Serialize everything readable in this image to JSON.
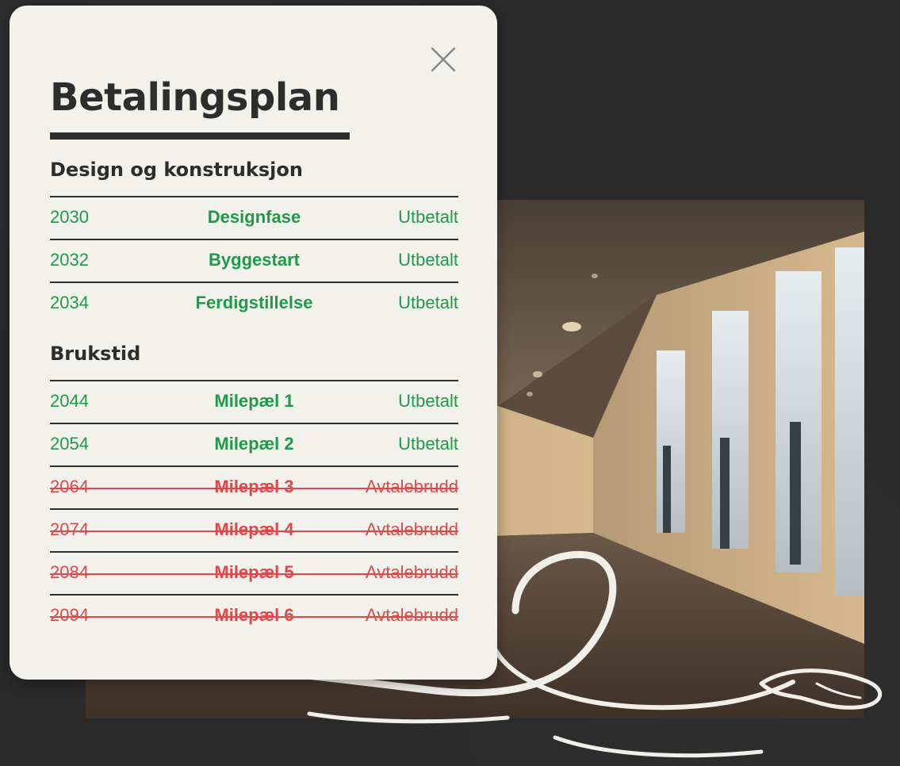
{
  "dialog": {
    "title": "Betalingsplan",
    "close_icon": "close-icon"
  },
  "sections": [
    {
      "title": "Design og konstruksjon",
      "rows": [
        {
          "year": "2030",
          "phase": "Designfase",
          "status": "Utbetalt",
          "state": "paid"
        },
        {
          "year": "2032",
          "phase": "Byggestart",
          "status": "Utbetalt",
          "state": "paid"
        },
        {
          "year": "2034",
          "phase": "Ferdigstillelse",
          "status": "Utbetalt",
          "state": "paid"
        }
      ]
    },
    {
      "title": "Brukstid",
      "rows": [
        {
          "year": "2044",
          "phase": "Milepæl 1",
          "status": "Utbetalt",
          "state": "paid"
        },
        {
          "year": "2054",
          "phase": "Milepæl 2",
          "status": "Utbetalt",
          "state": "paid"
        },
        {
          "year": "2064",
          "phase": "Milepæl 3",
          "status": "Avtalebrudd",
          "state": "breach"
        },
        {
          "year": "2074",
          "phase": "Milepæl 4",
          "status": "Avtalebrudd",
          "state": "breach"
        },
        {
          "year": "2084",
          "phase": "Milepæl 5",
          "status": "Avtalebrudd",
          "state": "breach"
        },
        {
          "year": "2094",
          "phase": "Milepæl 6",
          "status": "Avtalebrudd",
          "state": "breach"
        }
      ]
    }
  ],
  "colors": {
    "paid": "#1e9a4a",
    "breach": "#e0484a",
    "card_bg": "#f3f1ec",
    "text": "#2d2d2d"
  }
}
